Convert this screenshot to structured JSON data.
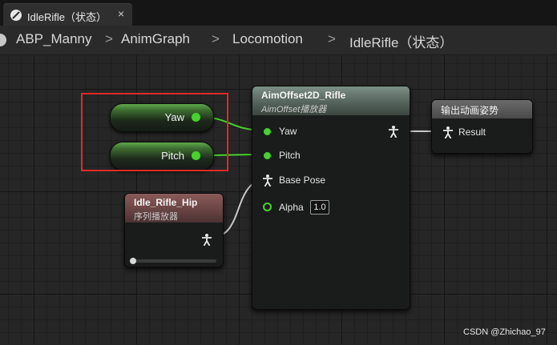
{
  "tab": {
    "title": "IdleRifle（状态）",
    "close": "×"
  },
  "breadcrumb": {
    "items": [
      "ABP_Manny",
      "AnimGraph",
      "Locomotion",
      "IdleRifle（状态）"
    ],
    "separator": ">"
  },
  "variables": [
    {
      "name": "Yaw"
    },
    {
      "name": "Pitch"
    }
  ],
  "aim_offset_node": {
    "title": "AimOffset2D_Rifle",
    "subtitle": "AimOffset播放器",
    "pins": {
      "yaw": "Yaw",
      "pitch": "Pitch",
      "base_pose": "Base Pose",
      "alpha": "Alpha",
      "alpha_value": "1.0"
    }
  },
  "output_pose_node": {
    "title": "输出动画姿势",
    "pin": "Result"
  },
  "sequence_node": {
    "title": "Idle_Rifle_Hip",
    "subtitle": "序列播放器",
    "play_rate": 0.0
  },
  "watermark": "CSDN @Zhichao_97",
  "colors": {
    "float_pin": "#46d22b",
    "highlight": "#e02a2a"
  }
}
